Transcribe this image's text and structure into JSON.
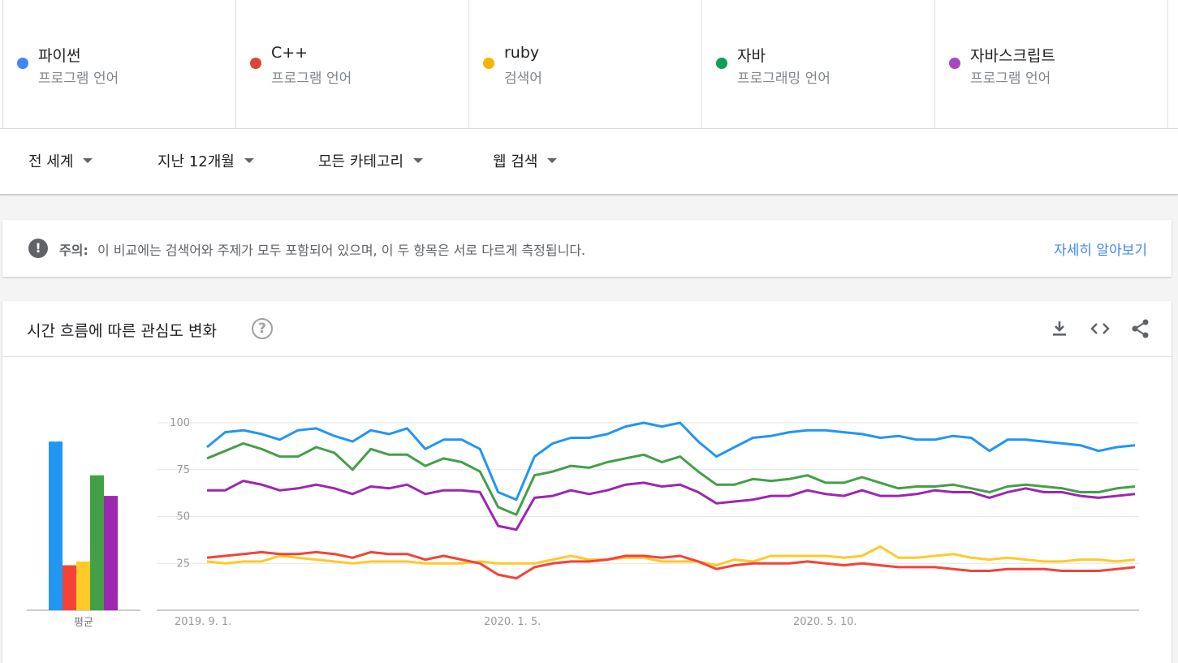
{
  "terms": [
    {
      "name": "파이썬",
      "sub": "프로그램 언어",
      "color": "#4285f4"
    },
    {
      "name": "C++",
      "sub": "프로그램 언어",
      "color": "#db4437"
    },
    {
      "name": "ruby",
      "sub": "검색어",
      "color": "#f4b400"
    },
    {
      "name": "자바",
      "sub": "프로그래밍 언어",
      "color": "#0f9d58"
    },
    {
      "name": "자바스크립트",
      "sub": "프로그램 언어",
      "color": "#ab47bc"
    }
  ],
  "filters": {
    "region": "전 세계",
    "period": "지난 12개월",
    "category": "모든 카테고리",
    "search_type": "웹 검색"
  },
  "notice": {
    "label": "주의:",
    "message": "이 비교에는 검색어와 주제가 모두 포함되어 있으며, 이 두 항목은 서로 다르게 측정됩니다.",
    "link": "자세히 알아보기"
  },
  "card": {
    "title": "시간 흐름에 따른 관심도 변화"
  },
  "icons": {
    "warning": "warning-icon",
    "help": "help-circle-icon",
    "download": "download-icon",
    "embed": "embed-code-icon",
    "share": "share-icon"
  },
  "chart_data": {
    "type": "line",
    "ylim": [
      0,
      100
    ],
    "yticks": [
      25,
      50,
      75,
      100
    ],
    "x_tick_labels": [
      "2019. 9. 1.",
      "2020. 1. 5.",
      "2020. 5. 10."
    ],
    "average_label": "평균",
    "averages": [
      90,
      24,
      26,
      72,
      61
    ],
    "series": [
      {
        "name": "파이썬",
        "color": "#2196f3",
        "values": [
          87,
          95,
          96,
          94,
          91,
          96,
          97,
          93,
          90,
          96,
          94,
          97,
          86,
          91,
          91,
          86,
          63,
          59,
          82,
          89,
          92,
          92,
          94,
          98,
          100,
          98,
          100,
          90,
          82,
          87,
          92,
          93,
          95,
          96,
          96,
          95,
          94,
          92,
          93,
          91,
          91,
          93,
          92,
          85,
          91,
          91,
          90,
          89,
          88,
          85,
          87,
          88
        ]
      },
      {
        "name": "C++",
        "color": "#f44336",
        "values": [
          28,
          29,
          30,
          31,
          30,
          30,
          31,
          30,
          28,
          31,
          30,
          30,
          27,
          29,
          27,
          25,
          19,
          17,
          23,
          25,
          26,
          26,
          27,
          29,
          29,
          28,
          29,
          26,
          22,
          24,
          25,
          25,
          25,
          26,
          25,
          24,
          25,
          24,
          23,
          23,
          23,
          22,
          21,
          21,
          22,
          22,
          22,
          21,
          21,
          21,
          22,
          23
        ]
      },
      {
        "name": "ruby",
        "color": "#ffca28",
        "values": [
          26,
          25,
          26,
          26,
          29,
          28,
          27,
          26,
          25,
          26,
          26,
          26,
          25,
          25,
          25,
          26,
          25,
          25,
          25,
          27,
          29,
          27,
          27,
          28,
          28,
          26,
          26,
          26,
          24,
          27,
          26,
          29,
          29,
          29,
          29,
          28,
          29,
          34,
          28,
          28,
          29,
          30,
          28,
          27,
          28,
          27,
          26,
          26,
          27,
          27,
          26,
          27
        ]
      },
      {
        "name": "자바",
        "color": "#43a047",
        "values": [
          81,
          85,
          89,
          86,
          82,
          82,
          87,
          84,
          75,
          86,
          83,
          83,
          77,
          81,
          79,
          74,
          55,
          51,
          72,
          74,
          77,
          76,
          79,
          81,
          83,
          79,
          82,
          74,
          67,
          67,
          70,
          69,
          70,
          72,
          68,
          68,
          71,
          68,
          65,
          66,
          66,
          67,
          65,
          63,
          66,
          67,
          66,
          65,
          63,
          63,
          65,
          66
        ]
      },
      {
        "name": "자바스크립트",
        "color": "#9c27b0",
        "values": [
          64,
          64,
          69,
          67,
          64,
          65,
          67,
          65,
          62,
          66,
          65,
          67,
          62,
          64,
          64,
          63,
          45,
          43,
          60,
          61,
          64,
          62,
          64,
          67,
          68,
          66,
          67,
          63,
          57,
          58,
          59,
          61,
          61,
          64,
          62,
          61,
          64,
          61,
          61,
          62,
          64,
          63,
          63,
          60,
          63,
          65,
          63,
          63,
          61,
          60,
          61,
          62
        ]
      }
    ]
  }
}
